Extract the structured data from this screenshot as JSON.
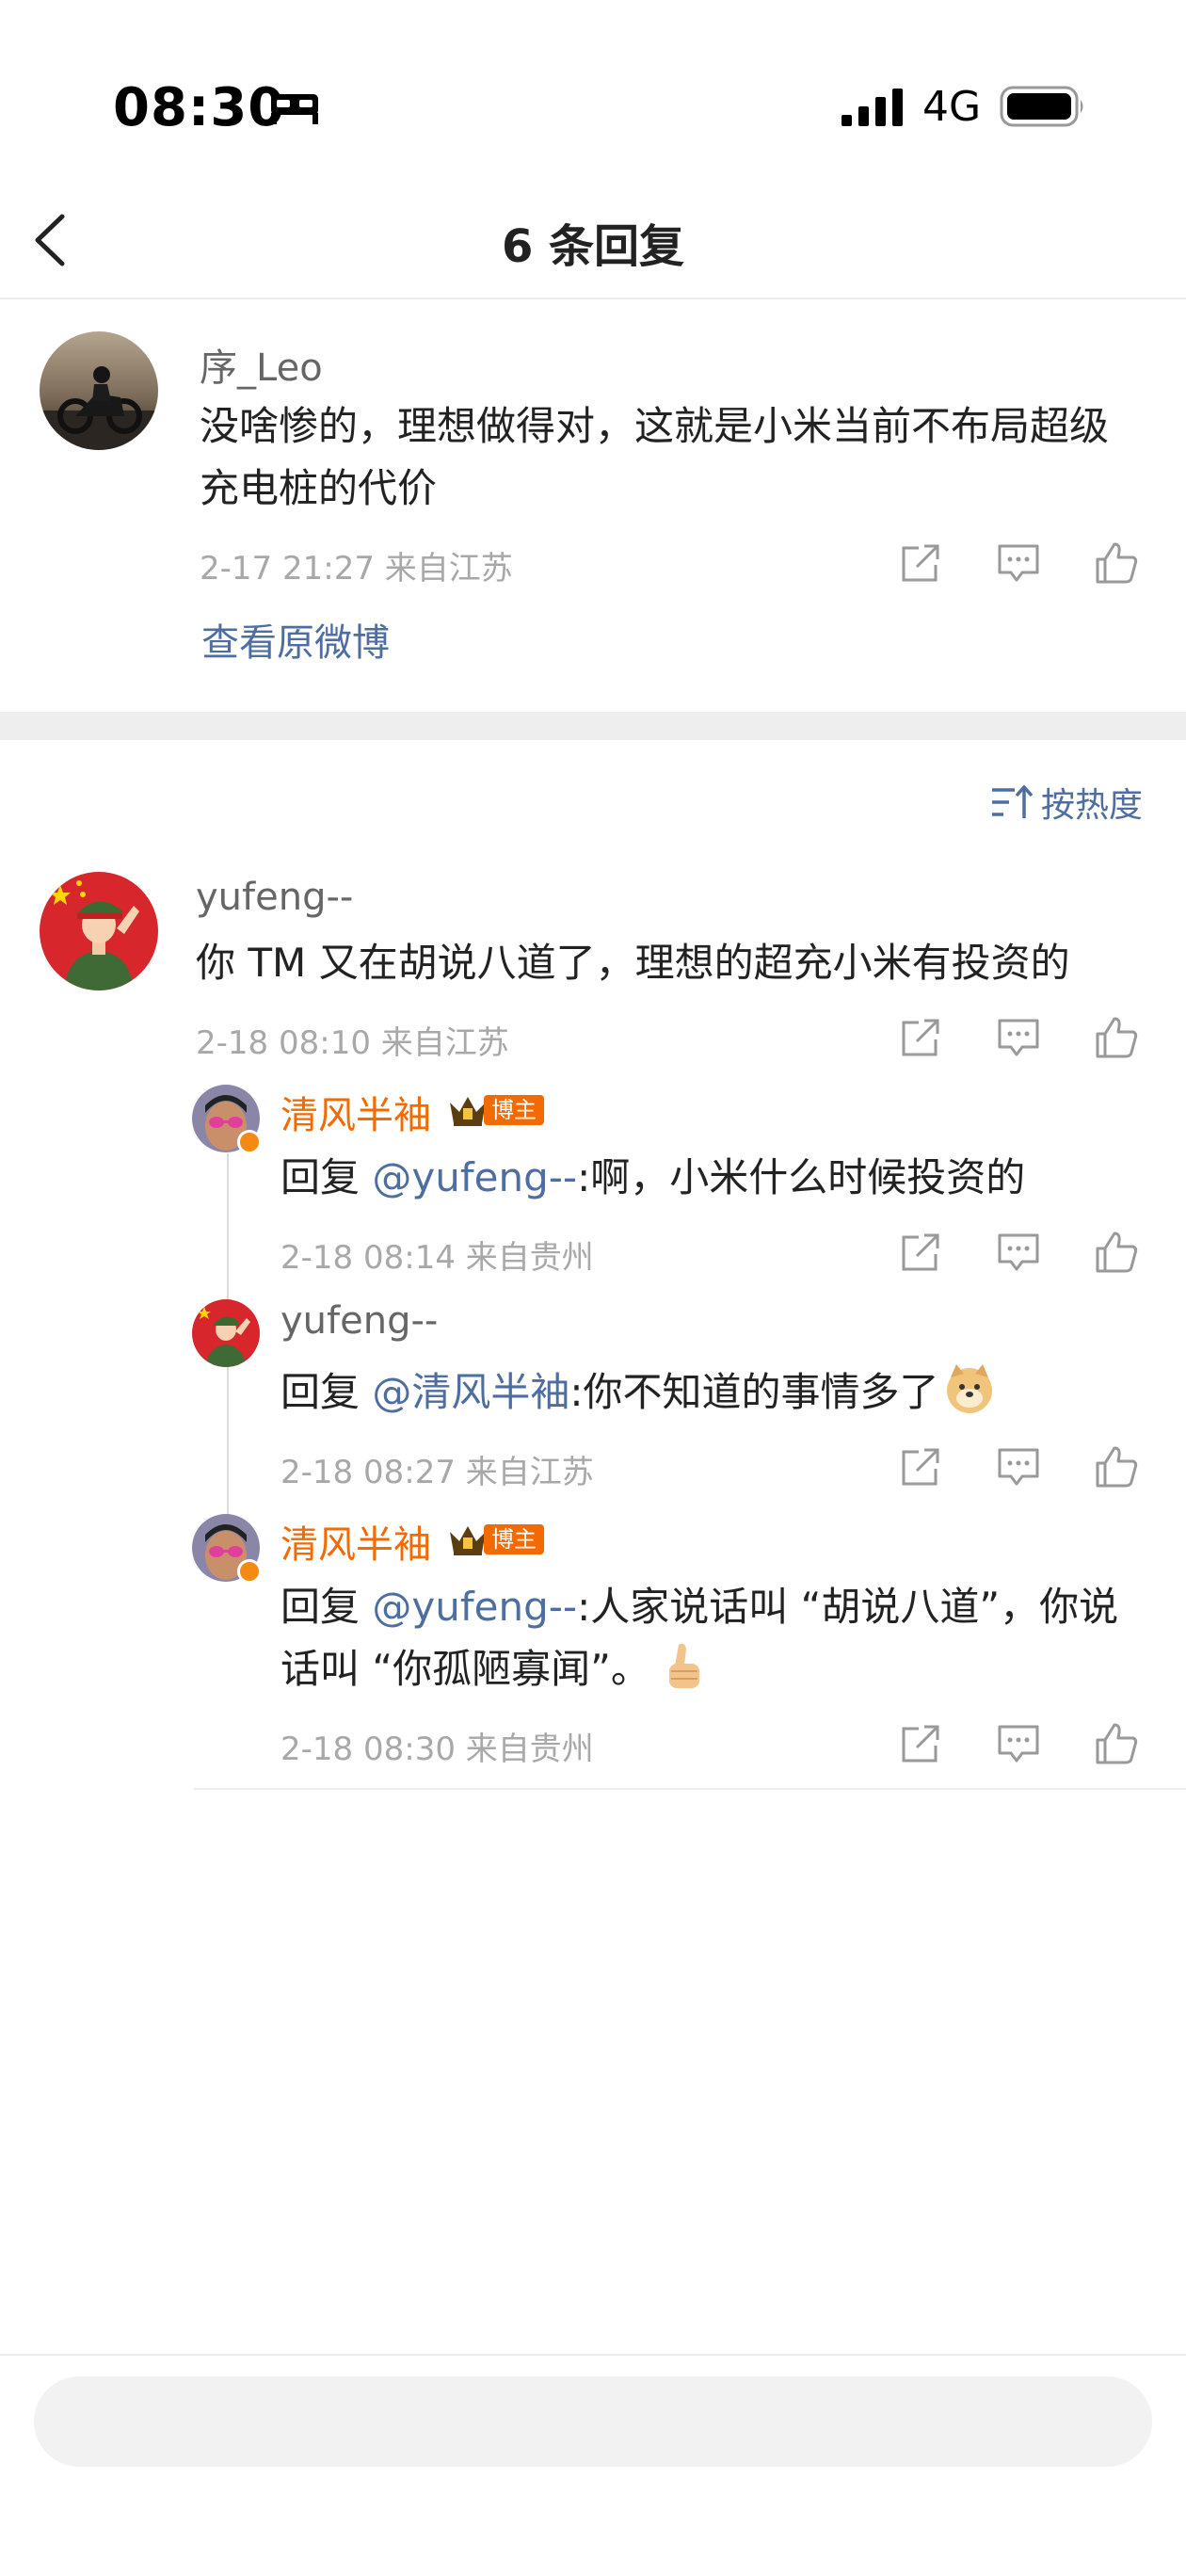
{
  "status_bar": {
    "time": "08:30",
    "network": "4G",
    "icons": [
      "bed-icon",
      "signal-icon",
      "battery-icon"
    ]
  },
  "nav": {
    "title": "6 条回复",
    "back_icon": "chevron-left-icon"
  },
  "original_comment": {
    "username": "序_Leo",
    "text": "没啥惨的，理想做得对，这就是小米当前不布局超级充电桩的代价",
    "meta": "2-17 21:27  来自江苏",
    "view_original": "查看原微博"
  },
  "sort": {
    "label": "按热度"
  },
  "comments": [
    {
      "username": "yufeng--",
      "text": "你 TM 又在胡说八道了，理想的超充小米有投资的",
      "meta": "2-18 08:10  来自江苏"
    }
  ],
  "replies": [
    {
      "username": "清风半袖",
      "badge": "博主",
      "prefix": "回复 ",
      "mention": "@yufeng--",
      "text": ":啊，小米什么时候投资的",
      "meta": "2-18 08:14  来自贵州"
    },
    {
      "username": "yufeng--",
      "prefix": "回复 ",
      "mention": "@清风半袖",
      "text": ":你不知道的事情多了",
      "meta": "2-18 08:27  来自江苏"
    },
    {
      "username": "清风半袖",
      "badge": "博主",
      "prefix": "回复 ",
      "mention": "@yufeng--",
      "text": ":人家说话叫 “胡说八道”，你说话叫 “你孤陋寡闻”。",
      "meta": "2-18 08:30  来自贵州"
    }
  ],
  "colors": {
    "accent_orange": "#f26a00",
    "link_blue": "#4e6ea2",
    "meta_gray": "#a8a8a8"
  }
}
